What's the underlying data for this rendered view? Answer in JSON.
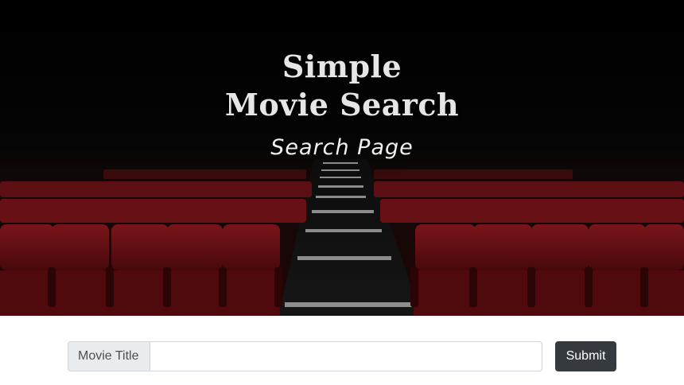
{
  "hero": {
    "title_line1": "Simple",
    "title_line2": "Movie Search",
    "subtitle": "Search Page",
    "background_image": "cinema-red-seats-aisle"
  },
  "search": {
    "label": "Movie Title",
    "value": "",
    "placeholder": "",
    "submit_label": "Submit"
  },
  "colors": {
    "seat_red": "#8a1518",
    "button_dark": "#343a40",
    "addon_bg": "#e9ecef",
    "title_text": "#e6e6e6"
  }
}
